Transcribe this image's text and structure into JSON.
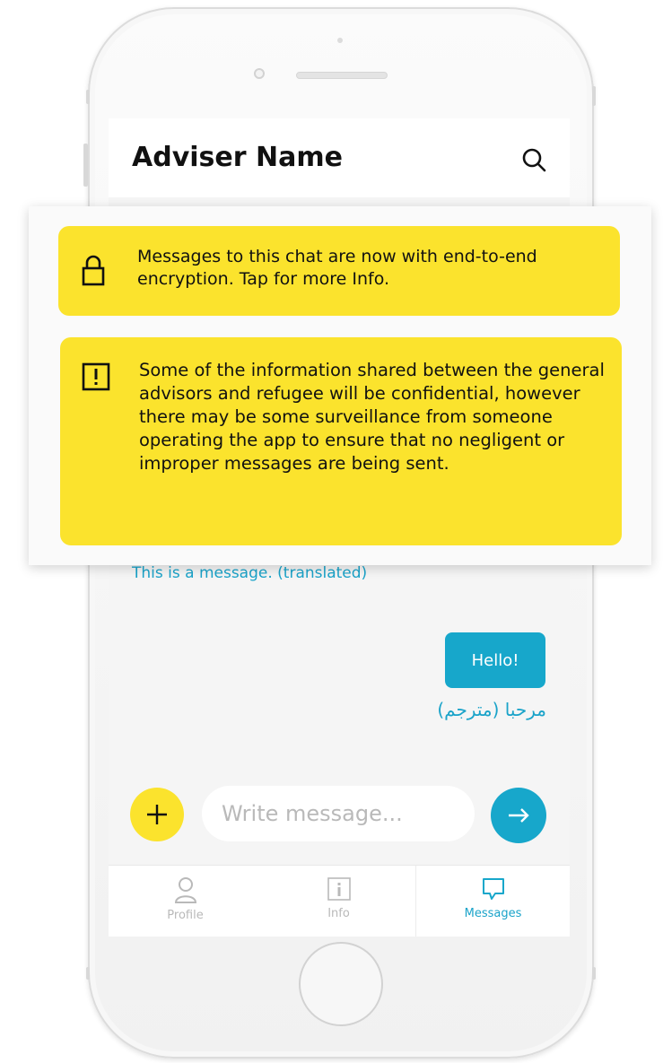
{
  "chat": {
    "title": "Adviser Name",
    "incoming_translated": "This is a message. (translated)",
    "outgoing_message": "Hello!",
    "outgoing_translated": "مرحبا (مترجم)"
  },
  "notices": {
    "encryption_text": "Messages to this chat are now with end-to-end encryption. Tap for more Info.",
    "surveillance_text": "Some of the information shared between the general advisors  and refugee will be confidential, however there may be some surveillance from someone operating the app to ensure that no negligent or improper messages are being sent."
  },
  "composer": {
    "placeholder": "Write message..."
  },
  "tabs": [
    {
      "label": "Profile",
      "icon": "person-icon",
      "active": false
    },
    {
      "label": "Info",
      "icon": "info-icon",
      "active": false
    },
    {
      "label": "Messages",
      "icon": "chat-bubble-icon",
      "active": true
    }
  ],
  "colors": {
    "accent_yellow": "#fbe32d",
    "accent_blue": "#17a7cb",
    "inactive_gray": "#b9b9b9"
  }
}
